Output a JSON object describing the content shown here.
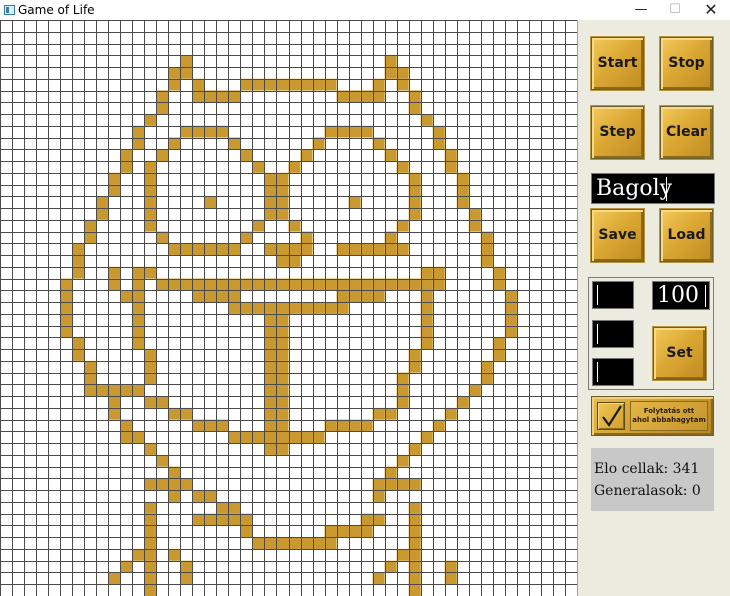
{
  "window": {
    "title": "Game of Life",
    "minimize_glyph": "—",
    "maximize_glyph": "☐",
    "close_glyph": "✕"
  },
  "grid": {
    "cols": 48,
    "rows": 49,
    "line_color": "#4a4a4a",
    "live_color": "#c9982e",
    "dead_color": "#ffffff",
    "live_cells": [
      [
        4,
        15
      ],
      [
        4,
        32
      ],
      [
        5,
        14
      ],
      [
        5,
        15
      ],
      [
        5,
        32
      ],
      [
        5,
        33
      ],
      [
        6,
        14
      ],
      [
        6,
        16
      ],
      [
        6,
        20
      ],
      [
        6,
        21
      ],
      [
        6,
        22
      ],
      [
        6,
        23
      ],
      [
        6,
        24
      ],
      [
        6,
        25
      ],
      [
        6,
        26
      ],
      [
        6,
        27
      ],
      [
        6,
        31
      ],
      [
        6,
        33
      ],
      [
        7,
        13
      ],
      [
        7,
        16
      ],
      [
        7,
        17
      ],
      [
        7,
        18
      ],
      [
        7,
        19
      ],
      [
        7,
        28
      ],
      [
        7,
        29
      ],
      [
        7,
        30
      ],
      [
        7,
        31
      ],
      [
        7,
        34
      ],
      [
        8,
        13
      ],
      [
        8,
        34
      ],
      [
        9,
        12
      ],
      [
        9,
        35
      ],
      [
        10,
        11
      ],
      [
        10,
        15
      ],
      [
        10,
        16
      ],
      [
        10,
        17
      ],
      [
        10,
        18
      ],
      [
        10,
        27
      ],
      [
        10,
        28
      ],
      [
        10,
        29
      ],
      [
        10,
        30
      ],
      [
        10,
        36
      ],
      [
        11,
        11
      ],
      [
        11,
        14
      ],
      [
        11,
        19
      ],
      [
        11,
        26
      ],
      [
        11,
        31
      ],
      [
        11,
        36
      ],
      [
        12,
        10
      ],
      [
        12,
        13
      ],
      [
        12,
        20
      ],
      [
        12,
        25
      ],
      [
        12,
        32
      ],
      [
        12,
        37
      ],
      [
        13,
        10
      ],
      [
        13,
        12
      ],
      [
        13,
        21
      ],
      [
        13,
        24
      ],
      [
        13,
        33
      ],
      [
        13,
        37
      ],
      [
        14,
        9
      ],
      [
        14,
        12
      ],
      [
        14,
        22
      ],
      [
        14,
        23
      ],
      [
        14,
        34
      ],
      [
        14,
        38
      ],
      [
        15,
        9
      ],
      [
        15,
        12
      ],
      [
        15,
        22
      ],
      [
        15,
        23
      ],
      [
        15,
        34
      ],
      [
        15,
        38
      ],
      [
        16,
        8
      ],
      [
        16,
        12
      ],
      [
        16,
        17
      ],
      [
        16,
        22
      ],
      [
        16,
        23
      ],
      [
        16,
        29
      ],
      [
        16,
        34
      ],
      [
        16,
        38
      ],
      [
        17,
        8
      ],
      [
        17,
        12
      ],
      [
        17,
        22
      ],
      [
        17,
        23
      ],
      [
        17,
        34
      ],
      [
        17,
        39
      ],
      [
        18,
        7
      ],
      [
        18,
        12
      ],
      [
        18,
        21
      ],
      [
        18,
        24
      ],
      [
        18,
        33
      ],
      [
        18,
        39
      ],
      [
        19,
        7
      ],
      [
        19,
        13
      ],
      [
        19,
        20
      ],
      [
        19,
        25
      ],
      [
        19,
        32
      ],
      [
        19,
        40
      ],
      [
        20,
        6
      ],
      [
        20,
        14
      ],
      [
        20,
        15
      ],
      [
        20,
        16
      ],
      [
        20,
        17
      ],
      [
        20,
        18
      ],
      [
        20,
        19
      ],
      [
        20,
        22
      ],
      [
        20,
        23
      ],
      [
        20,
        24
      ],
      [
        20,
        25
      ],
      [
        20,
        28
      ],
      [
        20,
        29
      ],
      [
        20,
        30
      ],
      [
        20,
        31
      ],
      [
        20,
        32
      ],
      [
        20,
        33
      ],
      [
        20,
        40
      ],
      [
        21,
        6
      ],
      [
        21,
        23
      ],
      [
        21,
        24
      ],
      [
        21,
        40
      ],
      [
        22,
        6
      ],
      [
        22,
        9
      ],
      [
        22,
        11
      ],
      [
        22,
        12
      ],
      [
        22,
        35
      ],
      [
        22,
        36
      ],
      [
        22,
        41
      ],
      [
        23,
        5
      ],
      [
        23,
        9
      ],
      [
        23,
        11
      ],
      [
        23,
        13
      ],
      [
        23,
        14
      ],
      [
        23,
        15
      ],
      [
        23,
        16
      ],
      [
        23,
        17
      ],
      [
        23,
        18
      ],
      [
        23,
        19
      ],
      [
        23,
        20
      ],
      [
        23,
        21
      ],
      [
        23,
        22
      ],
      [
        23,
        23
      ],
      [
        23,
        24
      ],
      [
        23,
        25
      ],
      [
        23,
        26
      ],
      [
        23,
        27
      ],
      [
        23,
        28
      ],
      [
        23,
        29
      ],
      [
        23,
        30
      ],
      [
        23,
        31
      ],
      [
        23,
        32
      ],
      [
        23,
        33
      ],
      [
        23,
        34
      ],
      [
        23,
        35
      ],
      [
        23,
        36
      ],
      [
        23,
        41
      ],
      [
        24,
        5
      ],
      [
        24,
        10
      ],
      [
        24,
        11
      ],
      [
        24,
        16
      ],
      [
        24,
        17
      ],
      [
        24,
        18
      ],
      [
        24,
        19
      ],
      [
        24,
        28
      ],
      [
        24,
        29
      ],
      [
        24,
        30
      ],
      [
        24,
        31
      ],
      [
        24,
        35
      ],
      [
        24,
        42
      ],
      [
        25,
        5
      ],
      [
        25,
        11
      ],
      [
        25,
        19
      ],
      [
        25,
        20
      ],
      [
        25,
        21
      ],
      [
        25,
        22
      ],
      [
        25,
        23
      ],
      [
        25,
        24
      ],
      [
        25,
        25
      ],
      [
        25,
        26
      ],
      [
        25,
        27
      ],
      [
        25,
        28
      ],
      [
        25,
        35
      ],
      [
        25,
        42
      ],
      [
        26,
        5
      ],
      [
        26,
        11
      ],
      [
        26,
        22
      ],
      [
        26,
        23
      ],
      [
        26,
        35
      ],
      [
        26,
        42
      ],
      [
        27,
        5
      ],
      [
        27,
        11
      ],
      [
        27,
        22
      ],
      [
        27,
        23
      ],
      [
        27,
        35
      ],
      [
        27,
        42
      ],
      [
        28,
        6
      ],
      [
        28,
        11
      ],
      [
        28,
        22
      ],
      [
        28,
        23
      ],
      [
        28,
        35
      ],
      [
        28,
        41
      ],
      [
        29,
        6
      ],
      [
        29,
        12
      ],
      [
        29,
        22
      ],
      [
        29,
        23
      ],
      [
        29,
        34
      ],
      [
        29,
        41
      ],
      [
        30,
        7
      ],
      [
        30,
        12
      ],
      [
        30,
        22
      ],
      [
        30,
        23
      ],
      [
        30,
        34
      ],
      [
        30,
        40
      ],
      [
        31,
        7
      ],
      [
        31,
        12
      ],
      [
        31,
        22
      ],
      [
        31,
        23
      ],
      [
        31,
        33
      ],
      [
        31,
        40
      ],
      [
        32,
        7
      ],
      [
        32,
        8
      ],
      [
        32,
        9
      ],
      [
        32,
        10
      ],
      [
        32,
        11
      ],
      [
        32,
        22
      ],
      [
        32,
        23
      ],
      [
        32,
        33
      ],
      [
        32,
        39
      ],
      [
        33,
        9
      ],
      [
        33,
        12
      ],
      [
        33,
        13
      ],
      [
        33,
        22
      ],
      [
        33,
        23
      ],
      [
        33,
        33
      ],
      [
        33,
        38
      ],
      [
        34,
        9
      ],
      [
        34,
        14
      ],
      [
        34,
        15
      ],
      [
        34,
        22
      ],
      [
        34,
        23
      ],
      [
        34,
        31
      ],
      [
        34,
        32
      ],
      [
        34,
        37
      ],
      [
        35,
        10
      ],
      [
        35,
        16
      ],
      [
        35,
        17
      ],
      [
        35,
        18
      ],
      [
        35,
        22
      ],
      [
        35,
        23
      ],
      [
        35,
        27
      ],
      [
        35,
        28
      ],
      [
        35,
        29
      ],
      [
        35,
        30
      ],
      [
        35,
        36
      ],
      [
        36,
        10
      ],
      [
        36,
        11
      ],
      [
        36,
        19
      ],
      [
        36,
        20
      ],
      [
        36,
        21
      ],
      [
        36,
        22
      ],
      [
        36,
        23
      ],
      [
        36,
        24
      ],
      [
        36,
        25
      ],
      [
        36,
        26
      ],
      [
        36,
        35
      ],
      [
        37,
        12
      ],
      [
        37,
        22
      ],
      [
        37,
        23
      ],
      [
        37,
        34
      ],
      [
        38,
        13
      ],
      [
        38,
        33
      ],
      [
        39,
        14
      ],
      [
        39,
        32
      ],
      [
        40,
        12
      ],
      [
        40,
        13
      ],
      [
        40,
        14
      ],
      [
        40,
        15
      ],
      [
        40,
        31
      ],
      [
        40,
        32
      ],
      [
        40,
        33
      ],
      [
        40,
        34
      ],
      [
        41,
        14
      ],
      [
        41,
        16
      ],
      [
        41,
        17
      ],
      [
        41,
        31
      ],
      [
        42,
        12
      ],
      [
        42,
        18
      ],
      [
        42,
        19
      ],
      [
        42,
        34
      ],
      [
        43,
        12
      ],
      [
        43,
        16
      ],
      [
        43,
        17
      ],
      [
        43,
        18
      ],
      [
        43,
        19
      ],
      [
        43,
        20
      ],
      [
        43,
        30
      ],
      [
        43,
        31
      ],
      [
        43,
        34
      ],
      [
        44,
        12
      ],
      [
        44,
        20
      ],
      [
        44,
        27
      ],
      [
        44,
        28
      ],
      [
        44,
        29
      ],
      [
        44,
        30
      ],
      [
        44,
        34
      ],
      [
        45,
        12
      ],
      [
        45,
        21
      ],
      [
        45,
        22
      ],
      [
        45,
        23
      ],
      [
        45,
        24
      ],
      [
        45,
        25
      ],
      [
        45,
        26
      ],
      [
        45,
        27
      ],
      [
        45,
        34
      ],
      [
        46,
        11
      ],
      [
        46,
        12
      ],
      [
        46,
        14
      ],
      [
        46,
        33
      ],
      [
        46,
        34
      ],
      [
        47,
        10
      ],
      [
        47,
        12
      ],
      [
        47,
        15
      ],
      [
        47,
        32
      ],
      [
        47,
        34
      ],
      [
        47,
        37
      ],
      [
        48,
        9
      ],
      [
        48,
        12
      ],
      [
        48,
        15
      ],
      [
        48,
        31
      ],
      [
        48,
        34
      ],
      [
        48,
        37
      ],
      [
        49,
        12
      ],
      [
        49,
        34
      ]
    ]
  },
  "controls": {
    "start_label": "Start",
    "stop_label": "Stop",
    "step_label": "Step",
    "clear_label": "Clear",
    "save_label": "Save",
    "load_label": "Load",
    "set_label": "Set",
    "pattern_name_value": "Bagoly",
    "number_value": "100",
    "continue_label_line1": "Folytatás ott",
    "continue_label_line2": "ahol abbahagytam",
    "continue_checked": true
  },
  "stats": {
    "live_cells_text": "Elo cellak: 341",
    "generations_text": "Generalasok: 0"
  }
}
